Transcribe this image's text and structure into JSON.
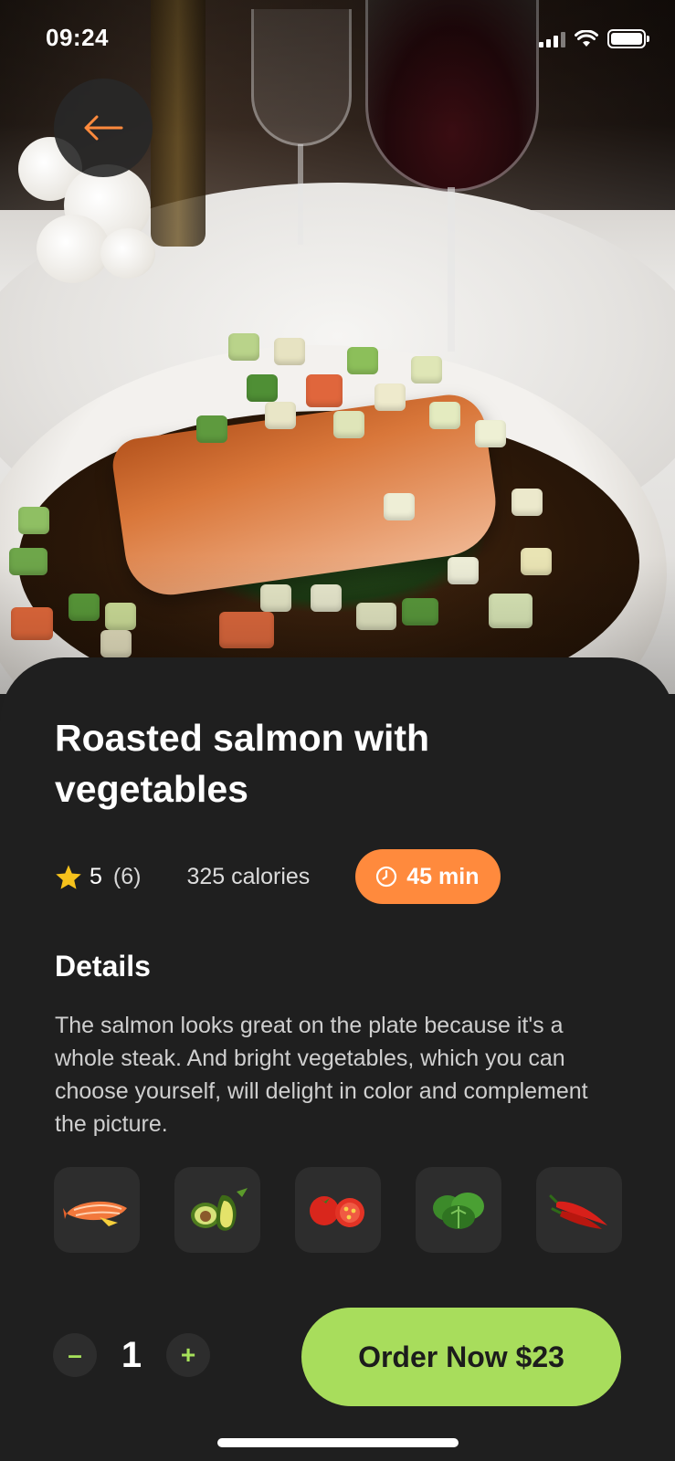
{
  "status_bar": {
    "time": "09:24"
  },
  "back_button": {
    "icon": "arrow-left-icon",
    "icon_color": "#ff8a3d"
  },
  "dish": {
    "title": "Roasted salmon with vegetables",
    "rating": "5",
    "reviews": "(6)",
    "calories": "325 calories",
    "cook_time": "45 min"
  },
  "details": {
    "heading": "Details",
    "text": "The salmon looks great on the plate because it's a whole steak. And bright vegetables, which you can choose yourself, will delight in color and complement the picture."
  },
  "ingredients": [
    {
      "name": "salmon",
      "icon": "salmon-icon"
    },
    {
      "name": "avocado",
      "icon": "avocado-icon"
    },
    {
      "name": "tomato",
      "icon": "tomato-icon"
    },
    {
      "name": "spinach",
      "icon": "spinach-icon"
    },
    {
      "name": "chili pepper",
      "icon": "chili-pepper-icon"
    }
  ],
  "order": {
    "decrement": "–",
    "quantity": "1",
    "increment": "+",
    "button_label": "Order Now $23"
  },
  "colors": {
    "accent_orange": "#ff8a3d",
    "accent_green": "#a8dd5c",
    "sheet_background": "#1f1f1f",
    "star": "#f6c21c"
  }
}
